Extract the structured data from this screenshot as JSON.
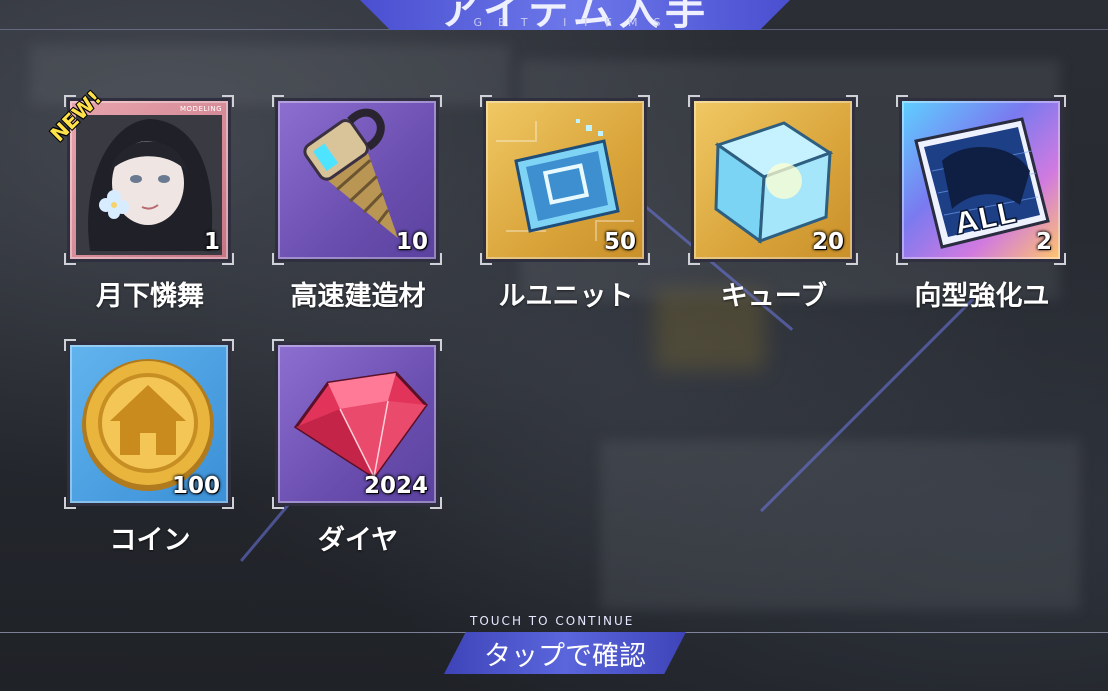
{
  "header": {
    "title": "アイテム入手",
    "subtitle": "GET ITEMS"
  },
  "items": [
    {
      "name": "月下憐舞",
      "qty": "1",
      "badge": "NEW!",
      "tag": "MODELING",
      "icon": "character-portrait-icon"
    },
    {
      "name": "高速建造材",
      "qty": "10",
      "icon": "drill-icon"
    },
    {
      "name": "ルユニット",
      "qty": "50",
      "icon": "circuit-chip-icon"
    },
    {
      "name": "キューブ",
      "qty": "20",
      "icon": "cube-icon"
    },
    {
      "name": "向型強化ユ",
      "qty": "2",
      "icon": "all-blueprint-icon"
    },
    {
      "name": "コイン",
      "qty": "100",
      "icon": "coin-icon"
    },
    {
      "name": "ダイヤ",
      "qty": "2024",
      "icon": "diamond-icon"
    }
  ],
  "footer": {
    "subtitle": "TOUCH TO CONTINUE",
    "label": "タップで確認"
  },
  "colors": {
    "accent": "#5b66dc",
    "gold_badge": "#ffe14a"
  }
}
